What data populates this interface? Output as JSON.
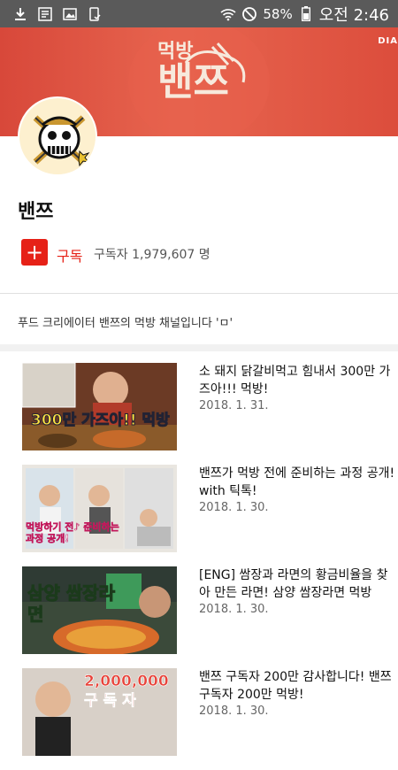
{
  "status_bar": {
    "battery": "58%",
    "time": "오전 2:46"
  },
  "banner": {
    "line1": "먹방",
    "line2": "밴쯔",
    "corner": "DIA"
  },
  "channel": {
    "name": "밴쯔",
    "subscribe_label": "구독",
    "subscriber_text": "구독자 1,979,607 명",
    "description": "푸드 크리에이터 밴쯔의 먹방 채널입니다 'ㅁ'"
  },
  "videos": [
    {
      "title": "소 돼지 닭갈비먹고 힘내서 300만 가즈아!!! 먹방!",
      "date": "2018. 1. 31.",
      "thumb_text": "300만 가즈아!! 먹방"
    },
    {
      "title": "밴쯔가 먹방 전에 준비하는 과정 공개! with 틱톡!",
      "date": "2018. 1. 30.",
      "thumb_text": "먹방하기 전♪ 준비하는 과정 공개!"
    },
    {
      "title": "[ENG] 쌈장과 라면의 황금비율을 찾아 만든 라면! 삼양 쌈장라면 먹방",
      "date": "2018. 1. 30.",
      "thumb_text": "삼양 쌈장라면"
    },
    {
      "title": "밴쯔 구독자 200만 감사합니다! 밴쯔 구독자 200만 먹방!",
      "date": "2018. 1. 30.",
      "thumb_text": "2,000,000 구 독 자"
    }
  ]
}
